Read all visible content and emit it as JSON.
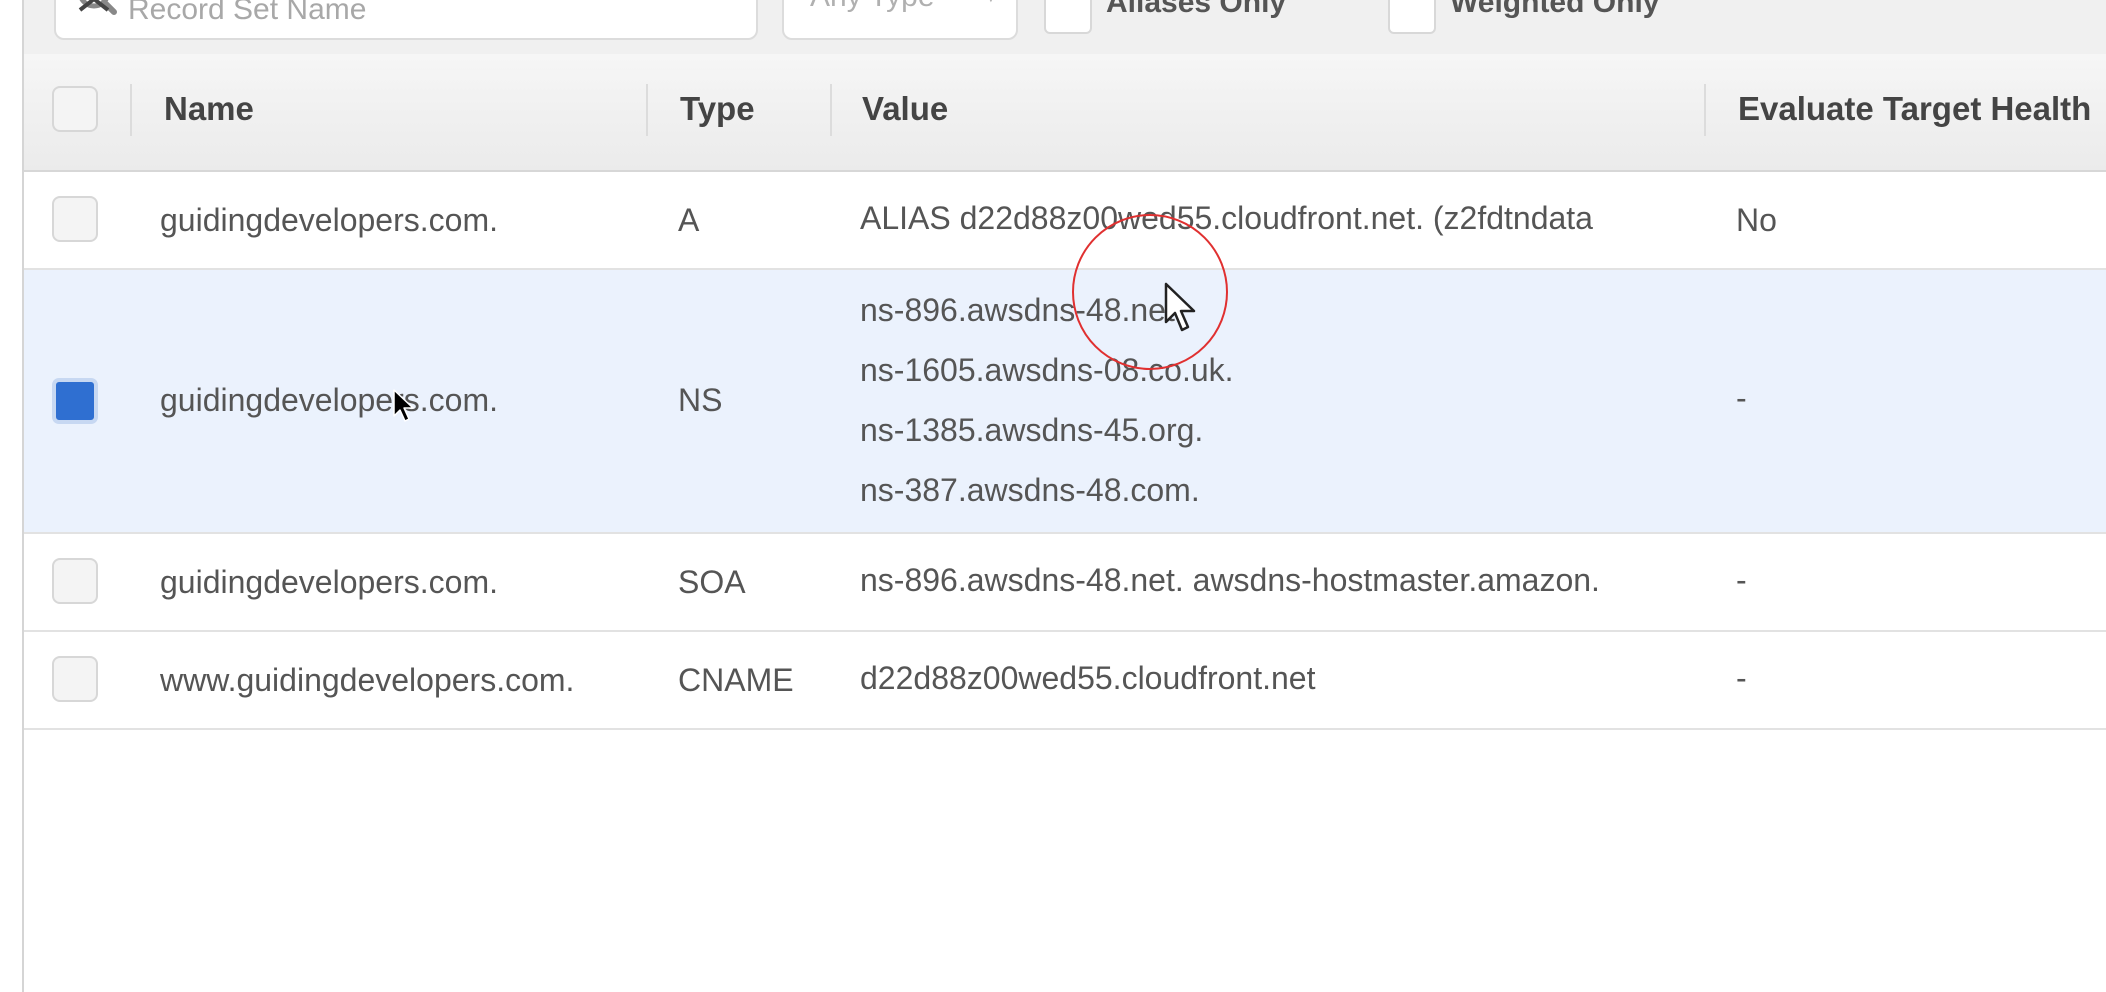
{
  "filters": {
    "search_placeholder": "Record Set Name",
    "type_select": "Any Type",
    "aliases_only": "Aliases Only",
    "weighted_only": "Weighted Only"
  },
  "table": {
    "headers": {
      "name": "Name",
      "type": "Type",
      "value": "Value",
      "evaluate": "Evaluate Target Health"
    },
    "rows": [
      {
        "name": "guidingdevelopers.com.",
        "type": "A",
        "value": "ALIAS d22d88z00wed55.cloudfront.net. (z2fdtndata",
        "evaluate": "No",
        "checked": false
      },
      {
        "name": "guidingdevelopers.com.",
        "type": "NS",
        "values": [
          "ns-896.awsdns-48.net.",
          "ns-1605.awsdns-08.co.uk.",
          "ns-1385.awsdns-45.org.",
          "ns-387.awsdns-48.com."
        ],
        "evaluate": "-",
        "checked": true
      },
      {
        "name": "guidingdevelopers.com.",
        "type": "SOA",
        "value": "ns-896.awsdns-48.net. awsdns-hostmaster.amazon.",
        "evaluate": "-",
        "checked": false
      },
      {
        "name": "www.guidingdevelopers.com.",
        "type": "CNAME",
        "value": "d22d88z00wed55.cloudfront.net",
        "evaluate": "-",
        "checked": false
      }
    ]
  },
  "colors": {
    "selected_row": "#ebf2fd",
    "checkbox_checked": "#2f6fd1",
    "header_bg": "#efefef"
  }
}
